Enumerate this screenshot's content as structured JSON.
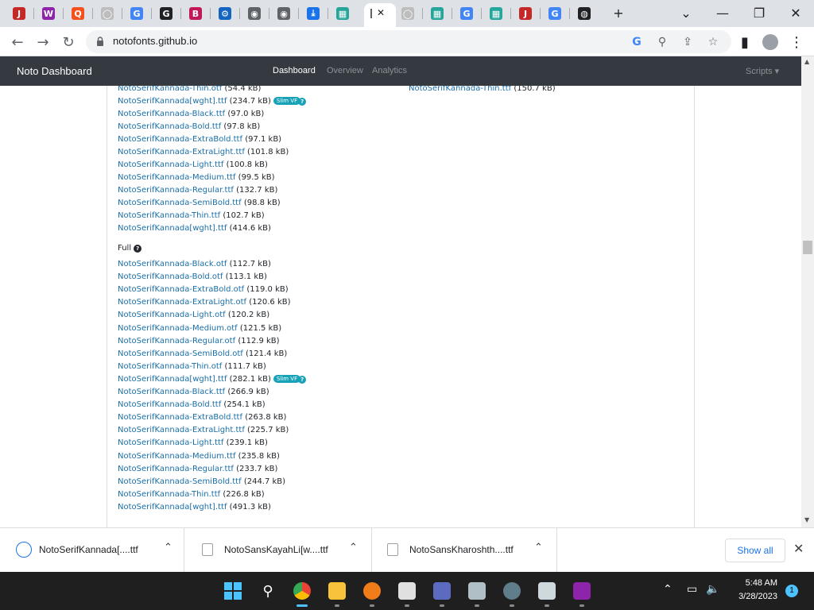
{
  "browser": {
    "url": "notofonts.github.io",
    "close_tab_glyph": "✕",
    "new_tab_glyph": "+",
    "tabs": [
      {
        "icon": "notofonts-icon",
        "color": "#c62828",
        "glyph": "J"
      },
      {
        "icon": "winrar-icon",
        "color": "#8e24aa",
        "glyph": "W"
      },
      {
        "icon": "app-icon",
        "color": "#f4511e",
        "glyph": "Q"
      },
      {
        "icon": "github-icon",
        "color": "#bdbdbd",
        "glyph": "◯"
      },
      {
        "icon": "google-icon",
        "color": "#4285f4",
        "glyph": "G"
      },
      {
        "icon": "google-icon",
        "color": "#202124",
        "glyph": "G"
      },
      {
        "icon": "app-icon",
        "color": "#c2185b",
        "glyph": "B"
      },
      {
        "icon": "gear-icon",
        "color": "#1565c0",
        "glyph": "⚙"
      },
      {
        "icon": "chrome-icon",
        "color": "#5f6368",
        "glyph": "◉"
      },
      {
        "icon": "chrome-icon",
        "color": "#5f6368",
        "glyph": "◉"
      },
      {
        "icon": "download-icon",
        "color": "#1a73e8",
        "glyph": "⤓"
      },
      {
        "icon": "app-icon",
        "color": "#26a69a",
        "glyph": "▦"
      }
    ],
    "tabs_after": [
      {
        "icon": "github-icon",
        "color": "#bdbdbd",
        "glyph": "◯"
      },
      {
        "icon": "app-icon",
        "color": "#26a69a",
        "glyph": "▦"
      },
      {
        "icon": "google-icon",
        "color": "#4285f4",
        "glyph": "G"
      },
      {
        "icon": "app-icon",
        "color": "#26a69a",
        "glyph": "▦"
      },
      {
        "icon": "notofonts-icon",
        "color": "#c62828",
        "glyph": "J"
      },
      {
        "icon": "google-icon",
        "color": "#4285f4",
        "glyph": "G"
      },
      {
        "icon": "globe-icon",
        "color": "#202124",
        "glyph": "◍"
      }
    ]
  },
  "site": {
    "brand": "Noto Dashboard",
    "nav": [
      "Dashboard",
      "Overview",
      "Analytics"
    ],
    "scripts_menu": "Scripts"
  },
  "files": {
    "top_list": [
      {
        "name": "NotoSerifKannada-Thin.otf",
        "size": "(54.4 kB)"
      },
      {
        "name": "NotoSerifKannada[wght].ttf",
        "size": "(234.7 kB)",
        "badge": "Slim VF"
      },
      {
        "name": "NotoSerifKannada-Black.ttf",
        "size": "(97.0 kB)"
      },
      {
        "name": "NotoSerifKannada-Bold.ttf",
        "size": "(97.8 kB)"
      },
      {
        "name": "NotoSerifKannada-ExtraBold.ttf",
        "size": "(97.1 kB)"
      },
      {
        "name": "NotoSerifKannada-ExtraLight.ttf",
        "size": "(101.8 kB)"
      },
      {
        "name": "NotoSerifKannada-Light.ttf",
        "size": "(100.8 kB)"
      },
      {
        "name": "NotoSerifKannada-Medium.ttf",
        "size": "(99.5 kB)"
      },
      {
        "name": "NotoSerifKannada-Regular.ttf",
        "size": "(132.7 kB)"
      },
      {
        "name": "NotoSerifKannada-SemiBold.ttf",
        "size": "(98.8 kB)"
      },
      {
        "name": "NotoSerifKannada-Thin.ttf",
        "size": "(102.7 kB)"
      },
      {
        "name": "NotoSerifKannada[wght].ttf",
        "size": "(414.6 kB)"
      }
    ],
    "right_list": [
      {
        "name": "NotoSerifKannada-Thin.ttf",
        "size": "(150.7 kB)"
      }
    ],
    "full_heading": "Full",
    "full_list": [
      {
        "name": "NotoSerifKannada-Black.otf",
        "size": "(112.7 kB)"
      },
      {
        "name": "NotoSerifKannada-Bold.otf",
        "size": "(113.1 kB)"
      },
      {
        "name": "NotoSerifKannada-ExtraBold.otf",
        "size": "(119.0 kB)"
      },
      {
        "name": "NotoSerifKannada-ExtraLight.otf",
        "size": "(120.6 kB)"
      },
      {
        "name": "NotoSerifKannada-Light.otf",
        "size": "(120.2 kB)"
      },
      {
        "name": "NotoSerifKannada-Medium.otf",
        "size": "(121.5 kB)"
      },
      {
        "name": "NotoSerifKannada-Regular.otf",
        "size": "(112.9 kB)"
      },
      {
        "name": "NotoSerifKannada-SemiBold.otf",
        "size": "(121.4 kB)"
      },
      {
        "name": "NotoSerifKannada-Thin.otf",
        "size": "(111.7 kB)"
      },
      {
        "name": "NotoSerifKannada[wght].ttf",
        "size": "(282.1 kB)",
        "badge": "Slim VF"
      },
      {
        "name": "NotoSerifKannada-Black.ttf",
        "size": "(266.9 kB)"
      },
      {
        "name": "NotoSerifKannada-Bold.ttf",
        "size": "(254.1 kB)"
      },
      {
        "name": "NotoSerifKannada-ExtraBold.ttf",
        "size": "(263.8 kB)"
      },
      {
        "name": "NotoSerifKannada-ExtraLight.ttf",
        "size": "(225.7 kB)"
      },
      {
        "name": "NotoSerifKannada-Light.ttf",
        "size": "(239.1 kB)"
      },
      {
        "name": "NotoSerifKannada-Medium.ttf",
        "size": "(235.8 kB)"
      },
      {
        "name": "NotoSerifKannada-Regular.ttf",
        "size": "(233.7 kB)"
      },
      {
        "name": "NotoSerifKannada-SemiBold.ttf",
        "size": "(244.7 kB)"
      },
      {
        "name": "NotoSerifKannada-Thin.ttf",
        "size": "(226.8 kB)"
      },
      {
        "name": "NotoSerifKannada[wght].ttf",
        "size": "(491.3 kB)"
      }
    ]
  },
  "downloads": {
    "items": [
      "NotoSerifKannada[....ttf",
      "NotoSansKayahLi[w....ttf",
      "NotoSansKharoshth....ttf"
    ],
    "show_all": "Show all"
  },
  "taskbar": {
    "time": "5:48 AM",
    "date": "3/28/2023",
    "notifications": "1"
  },
  "colors": {
    "link": "#1a6fa8",
    "badge": "#17a2b8",
    "navbar": "#343a40"
  }
}
